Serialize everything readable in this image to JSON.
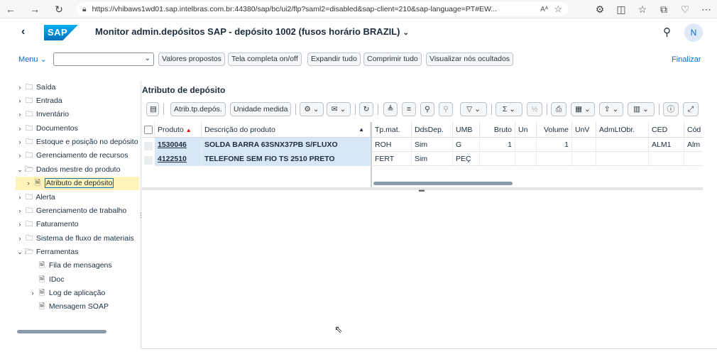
{
  "browser": {
    "url": "https://vhibaws1wd01.sap.intelbras.com.br:44380/sap/bc/ui2/flp?saml2=disabled&sap-client=210&sap-language=PT#EW...",
    "read_aloud": "Aᴬ",
    "avatar": "N"
  },
  "shell": {
    "logo": "SAP",
    "title": "Monitor admin.depósitos SAP - depósito 1002 (fusos horário BRAZIL)"
  },
  "toolbar": {
    "menu_label": "Menu",
    "buttons": [
      "Valores propostos",
      "Tela completa on/off",
      "Expandir tudo",
      "Comprimir tudo",
      "Visualizar nós ocultados"
    ],
    "finalizar": "Finalizar"
  },
  "tree": {
    "nodes": [
      {
        "label": "Saída",
        "expander": "›",
        "icon": "folder"
      },
      {
        "label": "Entrada",
        "expander": "›",
        "icon": "folder"
      },
      {
        "label": "Inventário",
        "expander": "›",
        "icon": "folder"
      },
      {
        "label": "Documentos",
        "expander": "›",
        "icon": "folder"
      },
      {
        "label": "Estoque e posição no depósito",
        "expander": "›",
        "icon": "folder"
      },
      {
        "label": "Gerenciamento de recursos",
        "expander": "›",
        "icon": "folder"
      },
      {
        "label": "Dados mestre do produto",
        "expander": "⌄",
        "icon": "folder-open"
      },
      {
        "label": "Atributo de depósito",
        "expander": "›",
        "icon": "document"
      },
      {
        "label": "Alerta",
        "expander": "›",
        "icon": "folder"
      },
      {
        "label": "Gerenciamento de trabalho",
        "expander": "›",
        "icon": "folder"
      },
      {
        "label": "Faturamento",
        "expander": "›",
        "icon": "folder"
      },
      {
        "label": "Sistema de fluxo de materiais",
        "expander": "›",
        "icon": "folder"
      },
      {
        "label": "Ferramentas",
        "expander": "⌄",
        "icon": "folder-open"
      },
      {
        "label": "Fila de mensagens",
        "expander": "",
        "icon": "document"
      },
      {
        "label": "IDoc",
        "expander": "",
        "icon": "document"
      },
      {
        "label": "Log de aplicação",
        "expander": "›",
        "icon": "document"
      },
      {
        "label": "Mensagem SOAP",
        "expander": "",
        "icon": "document"
      }
    ]
  },
  "panel": {
    "title": "Atributo de depósito",
    "grid_buttons": {
      "atrib": "Atrib.tp.depós.",
      "unidade": "Unidade medida",
      "sigma": "Σ"
    },
    "columns": [
      "Produto",
      "Descrição do produto",
      "Tp.mat.",
      "DdsDep.",
      "UMB",
      "Bruto",
      "Un",
      "Volume",
      "UnV",
      "AdmLtObr.",
      "CED",
      "Cód"
    ],
    "rows": [
      {
        "produto": "1530046",
        "descricao": "SOLDA BARRA 63SNX37PB S/FLUXO",
        "tpmat": "ROH",
        "ddsdep": "Sim",
        "umb": "G",
        "bruto": "1",
        "un": "",
        "volume": "1",
        "unv": "",
        "admltobr": "",
        "ced": "ALM1",
        "cod": "Alm"
      },
      {
        "produto": "4122510",
        "descricao": "TELEFONE SEM FIO TS 2510 PRETO",
        "tpmat": "FERT",
        "ddsdep": "Sim",
        "umb": "PEÇ",
        "bruto": "",
        "un": "",
        "volume": "",
        "unv": "",
        "admltobr": "",
        "ced": "",
        "cod": ""
      }
    ]
  },
  "colors": {
    "accent": "#0a6ed1",
    "selection": "#fff3b8",
    "key_cell": "#d6e8f7"
  }
}
